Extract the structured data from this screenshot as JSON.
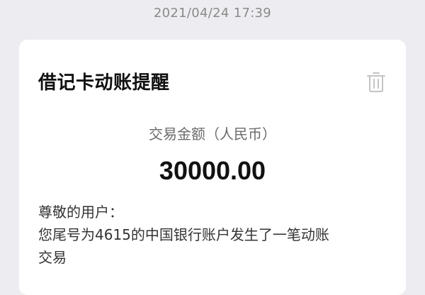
{
  "timestamp": "2021/04/24 17:39",
  "card": {
    "title": "借记卡动账提醒",
    "delete_icon": "trash-icon",
    "amount_label": "交易金额（人民币）",
    "amount_value": "30000.00",
    "greeting": "尊敬的用户：",
    "message_line1": "您尾号为4615的中国银行账户发生了一笔动账",
    "message_line2": "交易"
  },
  "colors": {
    "background": "#ededf1",
    "card": "#ffffff",
    "title": "#111111",
    "muted": "#8a8a8a"
  }
}
